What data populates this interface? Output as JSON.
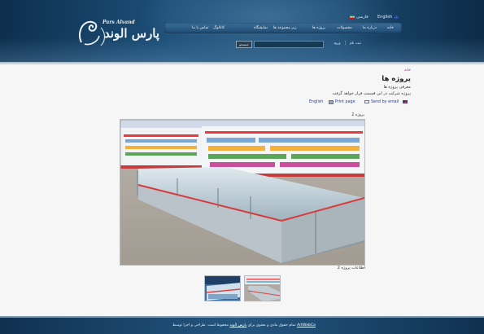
{
  "header": {
    "logo": {
      "en": "Pars Alvand",
      "fa": "پارس الوند"
    },
    "languages": [
      {
        "label": "English",
        "flag": "uk-flag-icon"
      },
      {
        "label": "فارسی",
        "flag": "iran-flag-icon"
      }
    ],
    "nav": [
      {
        "label": "خانه"
      },
      {
        "label": "درباره ما"
      },
      {
        "label": "محصولات"
      },
      {
        "label": "پروژه ها"
      },
      {
        "label": "زیر مجموعه ها"
      },
      {
        "label": "نمایشگاه"
      },
      {
        "label": "کاتالوگ"
      },
      {
        "label": "تماس با ما"
      }
    ],
    "login": {
      "button_label": "جستجو",
      "search_value": "",
      "enter_label": "ورود",
      "register_label": "ثبت نام"
    }
  },
  "content": {
    "breadcrumb": "خانه",
    "heading": "پروژه ها",
    "intro_1": "معرفی پروژه ها",
    "intro_2": "پروژه شرکت در این قسمت قرار خواهد گرفت",
    "tools": {
      "send_email": "Send by email",
      "print_page": "Print page",
      "english": "English"
    },
    "project_label": "پروژه 2",
    "photo_caption": "اطلاعات پروژه 2",
    "thumbnails": [
      "thumbnail-1",
      "thumbnail-2"
    ]
  },
  "footer": {
    "text_prefix": "تمام حقوق مادی و معنوی برای",
    "link_company": "پارس الوند",
    "text_middle": "محفوظ است. طراحی و اجرا توسط",
    "link_designer": "ArtWebCo"
  },
  "colors": {
    "header_dark": "#0d2f4e",
    "header_mid": "#1d4f78",
    "breadcrumb": "#8a2d80",
    "link": "#2440a3",
    "content_bg": "#f6f6f6"
  }
}
